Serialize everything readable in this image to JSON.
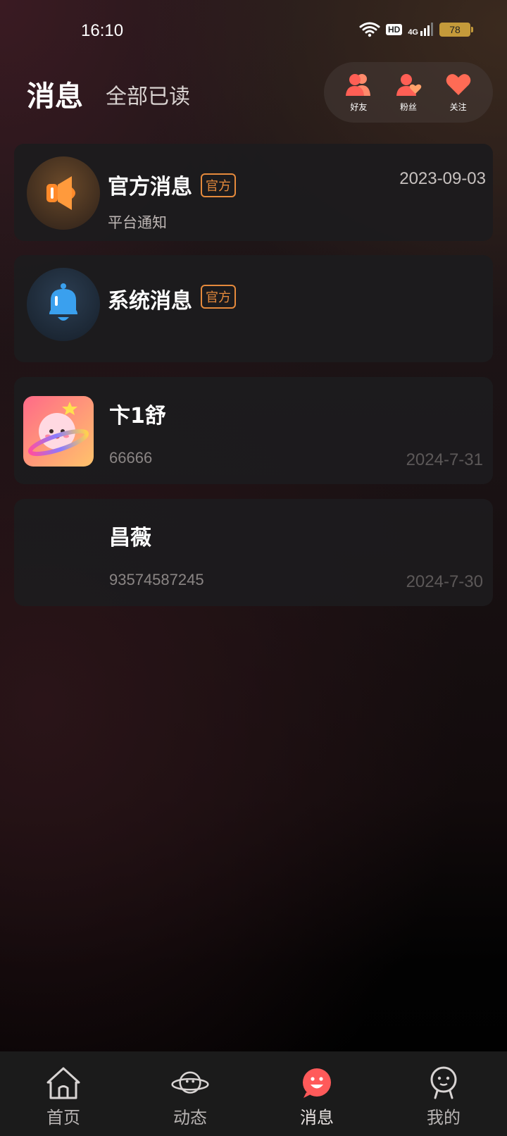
{
  "status_bar": {
    "time": "16:10",
    "hd_label": "HD",
    "network_label": "4G",
    "battery_level": "78"
  },
  "header": {
    "title": "消息",
    "mark_all_read": "全部已读",
    "quick_links": [
      {
        "label": "好友",
        "icon": "friends-icon"
      },
      {
        "label": "粉丝",
        "icon": "fans-icon"
      },
      {
        "label": "关注",
        "icon": "heart-icon"
      }
    ]
  },
  "messages": {
    "official": {
      "name": "官方消息",
      "tag": "官方",
      "subtitle": "平台通知",
      "date": "2023-09-03",
      "icon": "megaphone-icon"
    },
    "system": {
      "name": "系统消息",
      "tag": "官方",
      "icon": "bell-icon"
    },
    "chats": [
      {
        "name": "卞1舒",
        "preview": "66666",
        "date": "2024-7-31"
      },
      {
        "name": "昌薇",
        "preview": "93574587245",
        "date": "2024-7-30"
      }
    ]
  },
  "bottom_nav": [
    {
      "label": "首页",
      "icon": "home-icon"
    },
    {
      "label": "动态",
      "icon": "planet-icon"
    },
    {
      "label": "消息",
      "icon": "message-smile-icon",
      "active": true
    },
    {
      "label": "我的",
      "icon": "profile-icon"
    }
  ],
  "colors": {
    "accent_orange": "#e58a3c",
    "coral": "#ff6b5a",
    "bell_blue": "#3aa0ee"
  }
}
